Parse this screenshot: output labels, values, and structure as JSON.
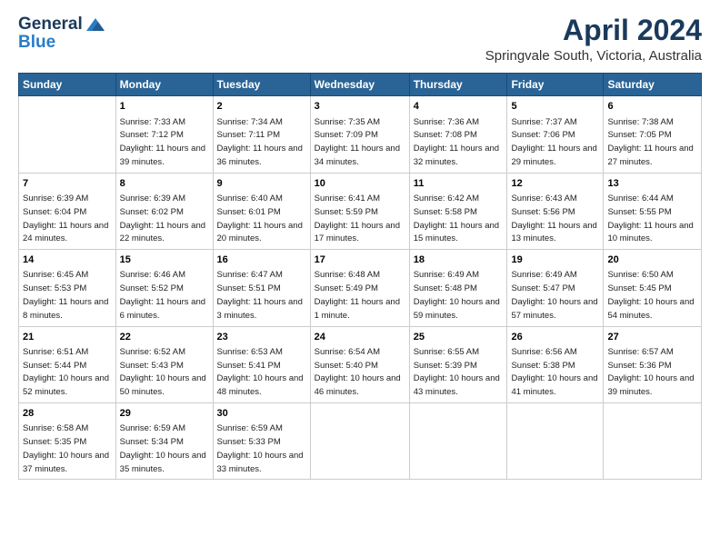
{
  "header": {
    "logo_line1": "General",
    "logo_line2": "Blue",
    "title": "April 2024",
    "subtitle": "Springvale South, Victoria, Australia"
  },
  "weekdays": [
    "Sunday",
    "Monday",
    "Tuesday",
    "Wednesday",
    "Thursday",
    "Friday",
    "Saturday"
  ],
  "weeks": [
    [
      {
        "day": "",
        "sunrise": "",
        "sunset": "",
        "daylight": ""
      },
      {
        "day": "1",
        "sunrise": "Sunrise: 7:33 AM",
        "sunset": "Sunset: 7:12 PM",
        "daylight": "Daylight: 11 hours and 39 minutes."
      },
      {
        "day": "2",
        "sunrise": "Sunrise: 7:34 AM",
        "sunset": "Sunset: 7:11 PM",
        "daylight": "Daylight: 11 hours and 36 minutes."
      },
      {
        "day": "3",
        "sunrise": "Sunrise: 7:35 AM",
        "sunset": "Sunset: 7:09 PM",
        "daylight": "Daylight: 11 hours and 34 minutes."
      },
      {
        "day": "4",
        "sunrise": "Sunrise: 7:36 AM",
        "sunset": "Sunset: 7:08 PM",
        "daylight": "Daylight: 11 hours and 32 minutes."
      },
      {
        "day": "5",
        "sunrise": "Sunrise: 7:37 AM",
        "sunset": "Sunset: 7:06 PM",
        "daylight": "Daylight: 11 hours and 29 minutes."
      },
      {
        "day": "6",
        "sunrise": "Sunrise: 7:38 AM",
        "sunset": "Sunset: 7:05 PM",
        "daylight": "Daylight: 11 hours and 27 minutes."
      }
    ],
    [
      {
        "day": "7",
        "sunrise": "Sunrise: 6:39 AM",
        "sunset": "Sunset: 6:04 PM",
        "daylight": "Daylight: 11 hours and 24 minutes."
      },
      {
        "day": "8",
        "sunrise": "Sunrise: 6:39 AM",
        "sunset": "Sunset: 6:02 PM",
        "daylight": "Daylight: 11 hours and 22 minutes."
      },
      {
        "day": "9",
        "sunrise": "Sunrise: 6:40 AM",
        "sunset": "Sunset: 6:01 PM",
        "daylight": "Daylight: 11 hours and 20 minutes."
      },
      {
        "day": "10",
        "sunrise": "Sunrise: 6:41 AM",
        "sunset": "Sunset: 5:59 PM",
        "daylight": "Daylight: 11 hours and 17 minutes."
      },
      {
        "day": "11",
        "sunrise": "Sunrise: 6:42 AM",
        "sunset": "Sunset: 5:58 PM",
        "daylight": "Daylight: 11 hours and 15 minutes."
      },
      {
        "day": "12",
        "sunrise": "Sunrise: 6:43 AM",
        "sunset": "Sunset: 5:56 PM",
        "daylight": "Daylight: 11 hours and 13 minutes."
      },
      {
        "day": "13",
        "sunrise": "Sunrise: 6:44 AM",
        "sunset": "Sunset: 5:55 PM",
        "daylight": "Daylight: 11 hours and 10 minutes."
      }
    ],
    [
      {
        "day": "14",
        "sunrise": "Sunrise: 6:45 AM",
        "sunset": "Sunset: 5:53 PM",
        "daylight": "Daylight: 11 hours and 8 minutes."
      },
      {
        "day": "15",
        "sunrise": "Sunrise: 6:46 AM",
        "sunset": "Sunset: 5:52 PM",
        "daylight": "Daylight: 11 hours and 6 minutes."
      },
      {
        "day": "16",
        "sunrise": "Sunrise: 6:47 AM",
        "sunset": "Sunset: 5:51 PM",
        "daylight": "Daylight: 11 hours and 3 minutes."
      },
      {
        "day": "17",
        "sunrise": "Sunrise: 6:48 AM",
        "sunset": "Sunset: 5:49 PM",
        "daylight": "Daylight: 11 hours and 1 minute."
      },
      {
        "day": "18",
        "sunrise": "Sunrise: 6:49 AM",
        "sunset": "Sunset: 5:48 PM",
        "daylight": "Daylight: 10 hours and 59 minutes."
      },
      {
        "day": "19",
        "sunrise": "Sunrise: 6:49 AM",
        "sunset": "Sunset: 5:47 PM",
        "daylight": "Daylight: 10 hours and 57 minutes."
      },
      {
        "day": "20",
        "sunrise": "Sunrise: 6:50 AM",
        "sunset": "Sunset: 5:45 PM",
        "daylight": "Daylight: 10 hours and 54 minutes."
      }
    ],
    [
      {
        "day": "21",
        "sunrise": "Sunrise: 6:51 AM",
        "sunset": "Sunset: 5:44 PM",
        "daylight": "Daylight: 10 hours and 52 minutes."
      },
      {
        "day": "22",
        "sunrise": "Sunrise: 6:52 AM",
        "sunset": "Sunset: 5:43 PM",
        "daylight": "Daylight: 10 hours and 50 minutes."
      },
      {
        "day": "23",
        "sunrise": "Sunrise: 6:53 AM",
        "sunset": "Sunset: 5:41 PM",
        "daylight": "Daylight: 10 hours and 48 minutes."
      },
      {
        "day": "24",
        "sunrise": "Sunrise: 6:54 AM",
        "sunset": "Sunset: 5:40 PM",
        "daylight": "Daylight: 10 hours and 46 minutes."
      },
      {
        "day": "25",
        "sunrise": "Sunrise: 6:55 AM",
        "sunset": "Sunset: 5:39 PM",
        "daylight": "Daylight: 10 hours and 43 minutes."
      },
      {
        "day": "26",
        "sunrise": "Sunrise: 6:56 AM",
        "sunset": "Sunset: 5:38 PM",
        "daylight": "Daylight: 10 hours and 41 minutes."
      },
      {
        "day": "27",
        "sunrise": "Sunrise: 6:57 AM",
        "sunset": "Sunset: 5:36 PM",
        "daylight": "Daylight: 10 hours and 39 minutes."
      }
    ],
    [
      {
        "day": "28",
        "sunrise": "Sunrise: 6:58 AM",
        "sunset": "Sunset: 5:35 PM",
        "daylight": "Daylight: 10 hours and 37 minutes."
      },
      {
        "day": "29",
        "sunrise": "Sunrise: 6:59 AM",
        "sunset": "Sunset: 5:34 PM",
        "daylight": "Daylight: 10 hours and 35 minutes."
      },
      {
        "day": "30",
        "sunrise": "Sunrise: 6:59 AM",
        "sunset": "Sunset: 5:33 PM",
        "daylight": "Daylight: 10 hours and 33 minutes."
      },
      {
        "day": "",
        "sunrise": "",
        "sunset": "",
        "daylight": ""
      },
      {
        "day": "",
        "sunrise": "",
        "sunset": "",
        "daylight": ""
      },
      {
        "day": "",
        "sunrise": "",
        "sunset": "",
        "daylight": ""
      },
      {
        "day": "",
        "sunrise": "",
        "sunset": "",
        "daylight": ""
      }
    ]
  ]
}
